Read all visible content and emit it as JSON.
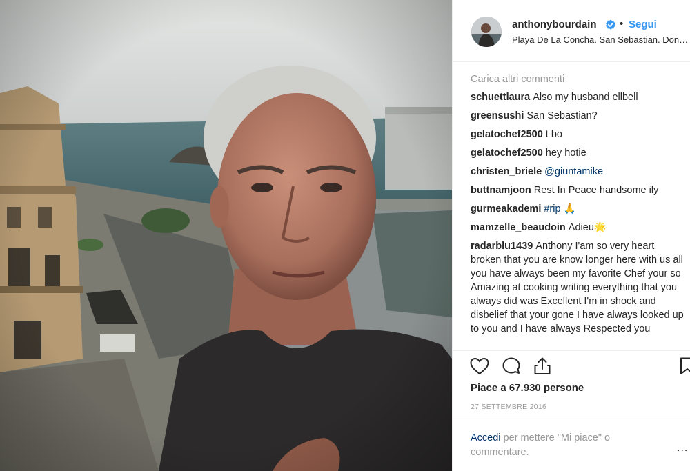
{
  "post": {
    "username": "anthonybourdain",
    "separator": "•",
    "follow_label": "Segui",
    "location": "Playa De La Concha. San Sebastian. Donostia",
    "photo_description_icon": "selfie-photo",
    "verified_color": "#3897f0"
  },
  "comments": {
    "load_more": "Carica altri commenti",
    "items": [
      {
        "user": "schuettlaura",
        "text": "Also my husband ellbell",
        "mention": ""
      },
      {
        "user": "greensushi",
        "text": "San Sebastian?",
        "mention": ""
      },
      {
        "user": "gelatochef2500",
        "text": "t bo",
        "mention": ""
      },
      {
        "user": "gelatochef2500",
        "text": "hey hotie",
        "mention": ""
      },
      {
        "user": "christen_briele",
        "text": "",
        "mention": "@giuntamike"
      },
      {
        "user": "buttnamjoon",
        "text": "Rest In Peace handsome ily",
        "mention": ""
      },
      {
        "user": "gurmeakademi",
        "text": " 🙏",
        "mention": "#rip"
      },
      {
        "user": "mamzelle_beaudoin",
        "text": "Adieu🌟",
        "mention": ""
      },
      {
        "user": "radarblu1439",
        "text": "Anthony I'am so very heart broken that you are know longer here with us all you have always been my favorite Chef your so Amazing at cooking writing everything that you always did was Excellent I'm in shock and disbelief that your gone I have always looked up to you and I have always Respected you",
        "mention": ""
      }
    ]
  },
  "actions": {
    "like_icon": "heart-icon",
    "comment_icon": "comment-icon",
    "share_icon": "share-icon",
    "save_icon": "bookmark-icon"
  },
  "likes": "Piace a 67.930 persone",
  "date": "27 settembre 2016",
  "login": {
    "link": "Accedi",
    "text": " per mettere \"Mi piace\" o commentare.",
    "more": "..."
  }
}
